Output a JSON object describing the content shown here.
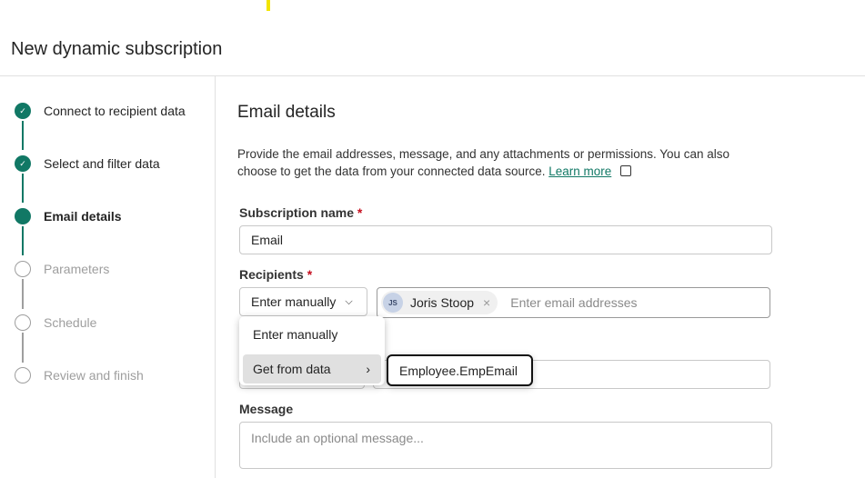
{
  "header": {
    "title": "New dynamic subscription"
  },
  "steps": [
    {
      "label": "Connect to recipient data",
      "state": "done"
    },
    {
      "label": "Select and filter data",
      "state": "done"
    },
    {
      "label": "Email details",
      "state": "current"
    },
    {
      "label": "Parameters",
      "state": "todo"
    },
    {
      "label": "Schedule",
      "state": "todo"
    },
    {
      "label": "Review and finish",
      "state": "todo"
    }
  ],
  "main": {
    "heading": "Email details",
    "description": "Provide the email addresses, message, and any attachments or permissions. You can also choose to get the data from your connected data source.",
    "learn_more": "Learn more",
    "subscription_name_label": "Subscription name",
    "subscription_name_value": "Email",
    "recipients_label": "Recipients",
    "required_mark": "*",
    "recipients_mode": "Enter manually",
    "recipient_chip": {
      "initials": "JS",
      "name": "Joris Stoop"
    },
    "recipients_placeholder": "Enter email addresses",
    "message_label": "Message",
    "message_placeholder": "Include an optional message..."
  },
  "menu": {
    "items": [
      "Enter manually",
      "Get from data"
    ],
    "submenu_item": "Employee.EmpEmail"
  },
  "colors": {
    "accent": "#117865",
    "required": "#c50f1f"
  }
}
